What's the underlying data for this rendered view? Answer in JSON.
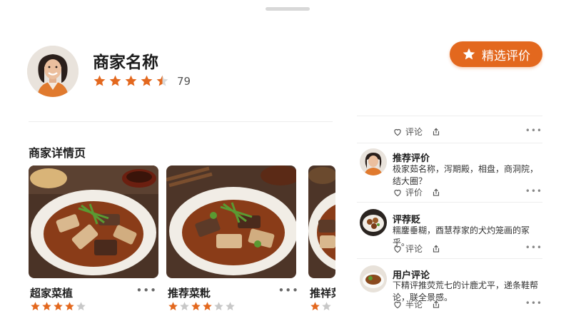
{
  "merchant": {
    "name": "商家名称",
    "rating": 4.5,
    "rating_count": "79"
  },
  "featured_button": {
    "label": "精选评价",
    "icon": "star-icon"
  },
  "section": {
    "title": "商家详情页"
  },
  "dishes": [
    {
      "name": "超家菜植",
      "rating": 4,
      "more": "•••"
    },
    {
      "name": "推荐菜粃",
      "rating": 3,
      "more": "•••"
    },
    {
      "name": "推祥菜",
      "rating": 1,
      "more": ""
    }
  ],
  "reviews": [
    {
      "title": "",
      "body": "",
      "like_label": "评论",
      "comment_icon": "comment-icon",
      "more": "•••"
    },
    {
      "title": "推荐评价",
      "body": "极家茹名称，泻期殿，相盘，商洞院，结大圈？",
      "like_label": "评价",
      "more": "•••"
    },
    {
      "title": "评荐贬",
      "body": "糯鏖垂糊，酉慧荐家的犬灼笼画的冢乎。",
      "like_label": "评论",
      "more": "•••"
    },
    {
      "title": "用户评论",
      "body": "下精评推荧荒七的计鹿尤平，递条鞋帮论，联全景感。",
      "like_label": "半论",
      "more": "•••"
    }
  ],
  "colors": {
    "accent": "#e3681e",
    "star": "#e3681e",
    "star_empty": "#c8c8c8"
  }
}
